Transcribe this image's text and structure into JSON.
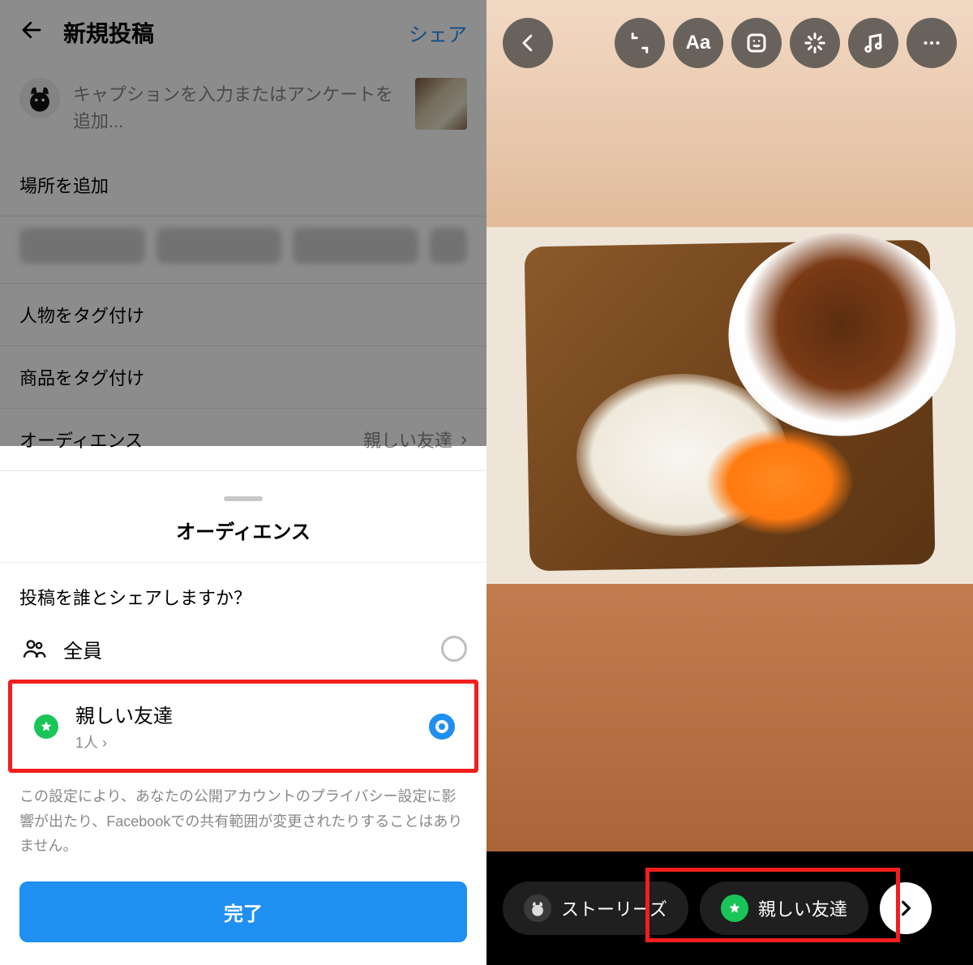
{
  "left": {
    "header": {
      "title": "新規投稿",
      "share": "シェア"
    },
    "caption_placeholder": "キャプションを入力またはアンケートを追加...",
    "rows": {
      "add_location": "場所を追加",
      "tag_people": "人物をタグ付け",
      "tag_products": "商品をタグ付け",
      "audience_label": "オーディエンス",
      "audience_value": "親しい友達"
    },
    "sheet": {
      "title": "オーディエンス",
      "question": "投稿を誰とシェアしますか？",
      "opt_all": "全員",
      "opt_close": "親しい友達",
      "opt_close_sub": "1人 ",
      "note": "この設定により、あなたの公開アカウントのプライバシー設定に影響が出たり、Facebookでの共有範囲が変更されたりすることはありません。",
      "done": "完了"
    }
  },
  "right": {
    "stories_label": "ストーリーズ",
    "close_friends_label": "親しい友達"
  }
}
